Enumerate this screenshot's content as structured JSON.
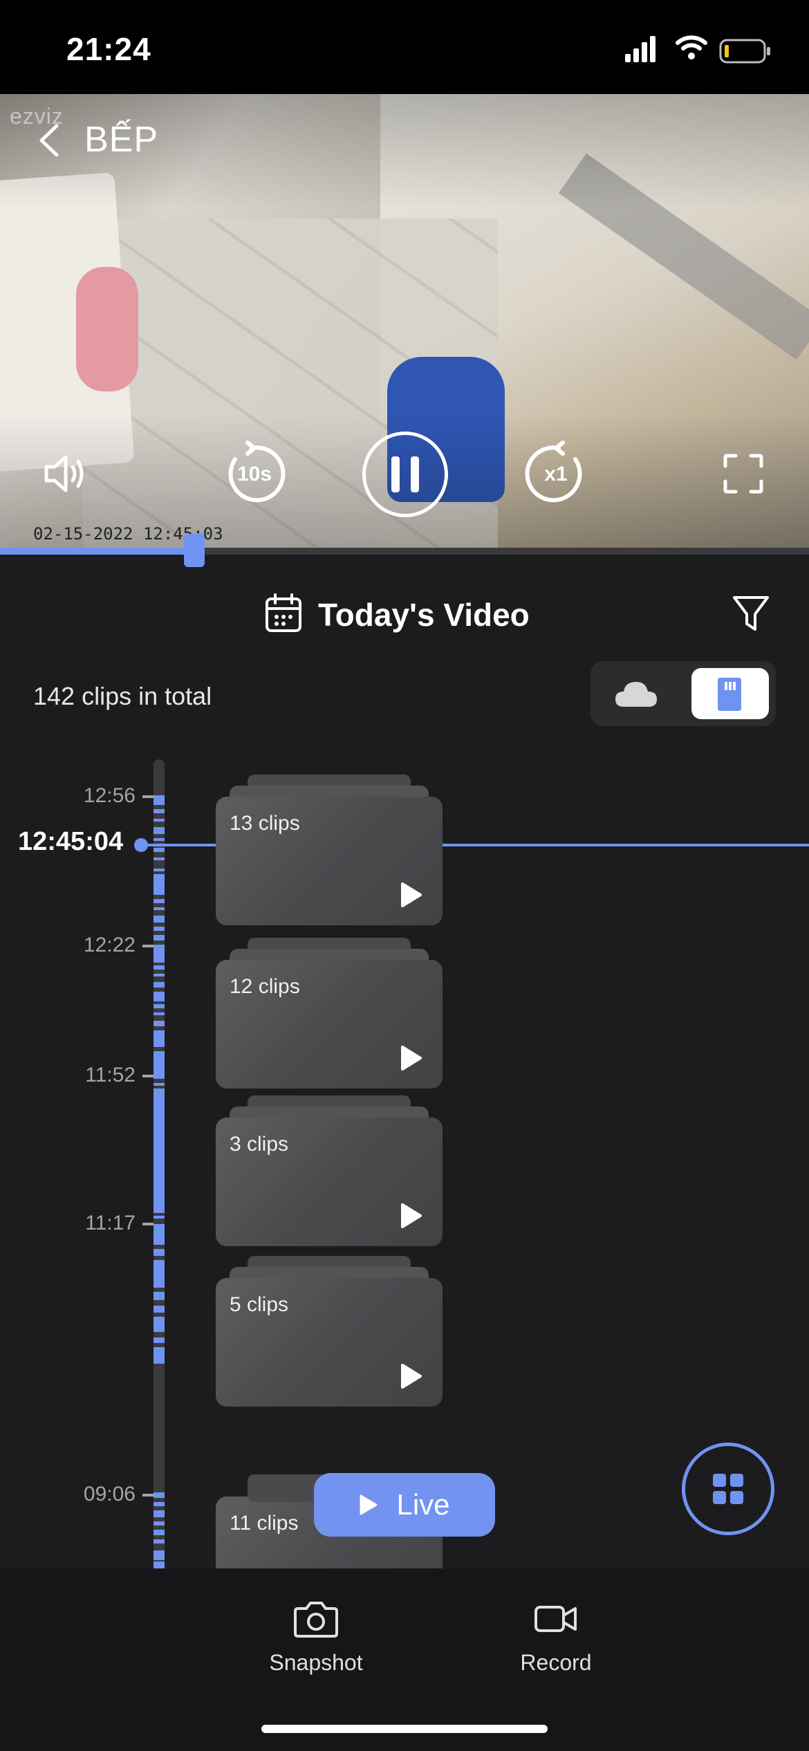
{
  "status_bar": {
    "time": "21:24"
  },
  "camera": {
    "brand_logo": "ezviz",
    "name": "BẾP",
    "timestamp": "02-15-2022 12:45:03",
    "playback_progress": 0.24
  },
  "controls": {
    "rewind_label": "10s",
    "speed_label": "x1",
    "icons": [
      "speaker-icon",
      "rewind-10s-icon",
      "pause-icon",
      "speed-x1-icon",
      "fullscreen-icon"
    ]
  },
  "video_list": {
    "title": "Today's Video",
    "clip_total": "142 clips in total",
    "storage_options": [
      "cloud",
      "sd-card"
    ],
    "selected_storage": "sd-card"
  },
  "timeline": {
    "current_time": "12:45:04",
    "ticks": [
      "12:56",
      "12:22",
      "11:52",
      "11:17",
      "09:06"
    ]
  },
  "clip_groups": [
    {
      "label": "13 clips"
    },
    {
      "label": "12 clips"
    },
    {
      "label": "3 clips"
    },
    {
      "label": "5 clips"
    },
    {
      "label": "11 clips"
    }
  ],
  "live_button": {
    "label": "Live"
  },
  "toolbar": {
    "snapshot_label": "Snapshot",
    "record_label": "Record"
  },
  "colors": {
    "accent": "#6f93f0",
    "background": "#1c1c1e"
  }
}
